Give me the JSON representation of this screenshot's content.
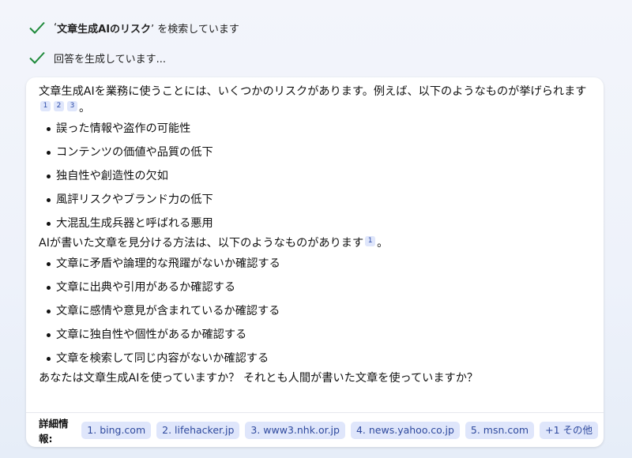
{
  "status": {
    "search_prefix": "‘",
    "search_query": "文章生成AIのリスク",
    "search_suffix": "’ を検索しています",
    "generating": "回答を生成しています..."
  },
  "answer": {
    "intro": "文章生成AIを業務に使うことには、いくつかのリスクがあります。例えば、以下のようなものが挙げられます",
    "intro_citations": [
      "1",
      "2",
      "3"
    ],
    "intro_end": "。",
    "risks": [
      "誤った情報や盗作の可能性",
      "コンテンツの価値や品質の低下",
      "独自性や創造性の欠如",
      "風評リスクやブランド力の低下",
      "大混乱生成兵器と呼ばれる悪用"
    ],
    "methods_intro": "AIが書いた文章を見分ける方法は、以下のようなものがあります",
    "methods_citation": "1",
    "methods_end": "。",
    "methods": [
      "文章に矛盾や論理的な飛躍がないか確認する",
      "文章に出典や引用があるか確認する",
      "文章に感情や意見が含まれているか確認する",
      "文章に独自性や個性があるか確認する",
      "文章を検索して同じ内容がないか確認する"
    ],
    "question": "あなたは文章生成AIを使っていますか？ それとも人間が書いた文章を使っていますか？"
  },
  "sources": {
    "label": "詳細情報:",
    "links": [
      "1. bing.com",
      "2. lifehacker.jp",
      "3. www3.nhk.or.jp",
      "4. news.yahoo.co.jp",
      "5. msn.com",
      "+1 その他"
    ]
  },
  "colors": {
    "check": "#1f8a3b",
    "chip_bg": "#dfe6fb",
    "chip_text": "#2f4a9e"
  }
}
